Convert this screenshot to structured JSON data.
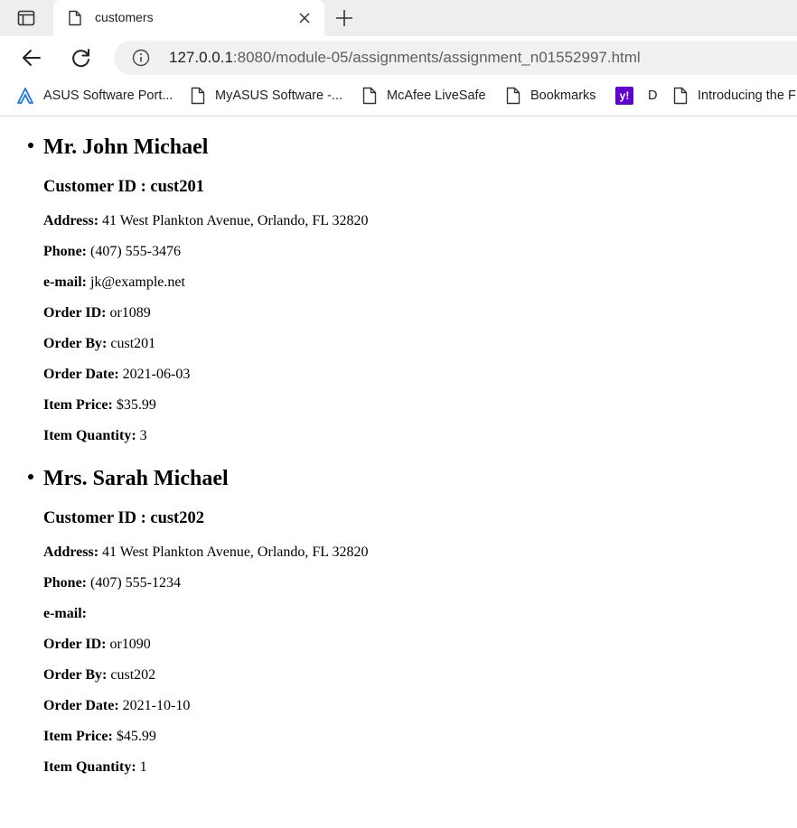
{
  "browser": {
    "tab_title": "customers",
    "url_host": "127.0.0.1",
    "url_rest": ":8080/module-05/assignments/assignment_n01552997.html",
    "bookmarks": [
      {
        "label": "ASUS Software Port...",
        "icon": "asus-icon"
      },
      {
        "label": "MyASUS Software -...",
        "icon": "page-icon"
      },
      {
        "label": "McAfee LiveSafe",
        "icon": "page-icon"
      },
      {
        "label": "Bookmarks",
        "icon": "page-icon"
      },
      {
        "label": "D",
        "icon": "yahoo-icon"
      },
      {
        "label": "Introducing the F",
        "icon": "page-icon"
      }
    ]
  },
  "customers": [
    {
      "name": "Mr. John Michael",
      "id_line": "Customer ID : cust201",
      "fields": [
        {
          "label": "Address:",
          "value": " 41 West Plankton Avenue, Orlando, FL 32820"
        },
        {
          "label": "Phone:",
          "value": " (407) 555-3476"
        },
        {
          "label": "e-mail:",
          "value": " jk@example.net"
        },
        {
          "label": "Order ID:",
          "value": " or1089"
        },
        {
          "label": "Order By:",
          "value": " cust201"
        },
        {
          "label": "Order Date:",
          "value": " 2021-06-03"
        },
        {
          "label": "Item Price:",
          "value": " $35.99"
        },
        {
          "label": "Item Quantity:",
          "value": " 3"
        }
      ]
    },
    {
      "name": "Mrs. Sarah Michael",
      "id_line": "Customer ID : cust202",
      "fields": [
        {
          "label": "Address:",
          "value": " 41 West Plankton Avenue, Orlando, FL 32820"
        },
        {
          "label": "Phone:",
          "value": " (407) 555-1234"
        },
        {
          "label": "e-mail:",
          "value": ""
        },
        {
          "label": "Order ID:",
          "value": " or1090"
        },
        {
          "label": "Order By:",
          "value": " cust202"
        },
        {
          "label": "Order Date:",
          "value": " 2021-10-10"
        },
        {
          "label": "Item Price:",
          "value": " $45.99"
        },
        {
          "label": "Item Quantity:",
          "value": " 1"
        }
      ]
    }
  ]
}
